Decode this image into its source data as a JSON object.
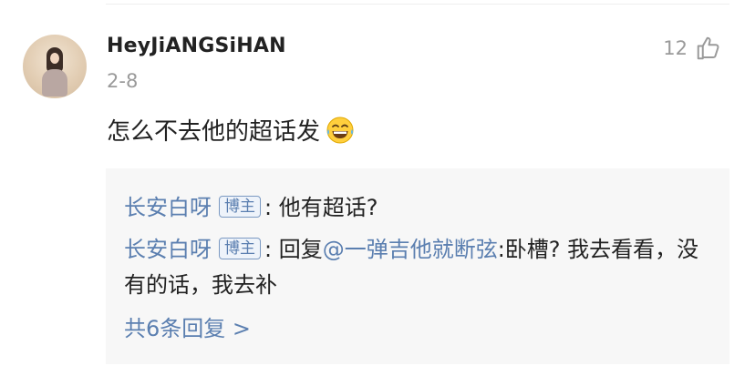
{
  "comment": {
    "username": "HeyJiANGSiHAN",
    "date": "2-8",
    "like_count": "12",
    "text": "怎么不去他的超话发",
    "emoji": "laughing-tears-emoji"
  },
  "replies": [
    {
      "author": "长安白呀",
      "badge": "博主",
      "separator": ": ",
      "text": "他有超话?"
    },
    {
      "author": "长安白呀",
      "badge": "博主",
      "separator": ": ",
      "prefix": "回复",
      "mention": "@一弹吉他就断弦",
      "text": ":卧槽? 我去看看，没有的话，我去补"
    }
  ],
  "more_replies": "共6条回复 >",
  "colors": {
    "link": "#5b7fb0",
    "meta": "#9a9a9a",
    "reply_bg": "#f7f7f7"
  }
}
